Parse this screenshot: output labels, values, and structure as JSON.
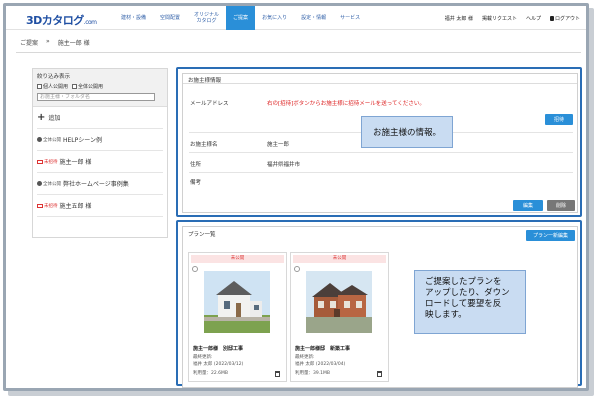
{
  "header": {
    "logo_main": "3Dカタログ",
    "logo_suffix": ".com",
    "nav": [
      {
        "label": "建材・設備"
      },
      {
        "label": "空間配置"
      },
      {
        "label": "オリジナル\nカタログ"
      },
      {
        "label": "ご提案"
      },
      {
        "label": "お気に入り"
      },
      {
        "label": "設定・情報"
      },
      {
        "label": "サービス"
      }
    ],
    "user_name": "福井 太郎 様",
    "request_link": "掲載リクエスト",
    "help_link": "ヘルプ",
    "logout_link": "ログアウト"
  },
  "breadcrumb": [
    "ご提案",
    "»",
    "施主一郎 様"
  ],
  "sidebar": {
    "filter_title": "絞り込み表示",
    "filter_private": "個人公開用",
    "filter_public": "全体公開用",
    "search_placeholder": "お施主様・フォルダ名",
    "add_label": "追加",
    "items": [
      {
        "tag": "全体公開",
        "name": "HELPシーン例",
        "kind": "public"
      },
      {
        "tag": "未招待",
        "name": "施主一郎 様",
        "kind": "uninvited"
      },
      {
        "tag": "全体公開",
        "name": "弊社ホームページ事例集",
        "kind": "public"
      },
      {
        "tag": "未招待",
        "name": "施主五郎 様",
        "kind": "uninvited"
      }
    ]
  },
  "owner": {
    "section_title": "お施主様情報",
    "email_label": "メールアドレス",
    "email_message": "右の[招待]ボタンからお施主様に招待メールを送ってください。",
    "invite_button": "招待",
    "name_label": "お施主様名",
    "name_value": "施主一郎",
    "address_label": "住所",
    "address_value": "福井県福井市",
    "notes_label": "備考",
    "edit_button": "編集",
    "delete_button": "削除"
  },
  "callout_owner": "お施主様の情報。",
  "plans": {
    "section_title": "プラン一覧",
    "new_plan_button": "プラン一新編集",
    "cards": [
      {
        "status": "未公開",
        "title": "施主一郎様　別邸工事",
        "updated_label": "最終更新:",
        "updated_by": "福井 太郎 (2022/03/12)",
        "usage": "利用量：22.6MB"
      },
      {
        "status": "未公開",
        "title": "施主一郎様邸　新築工事",
        "updated_label": "最終更新:",
        "updated_by": "福井 太郎 (2022/03/04)",
        "usage": "利用量：39.1MB"
      }
    ]
  },
  "callout_plans": "ご提案したプランを\nアップしたり、ダウン\nロードして要望を反\n映します。",
  "colors": {
    "accent": "#2a8fd8",
    "outline": "#2a6db5",
    "callout": "#c9dcf2",
    "warn": "#dd2222"
  }
}
